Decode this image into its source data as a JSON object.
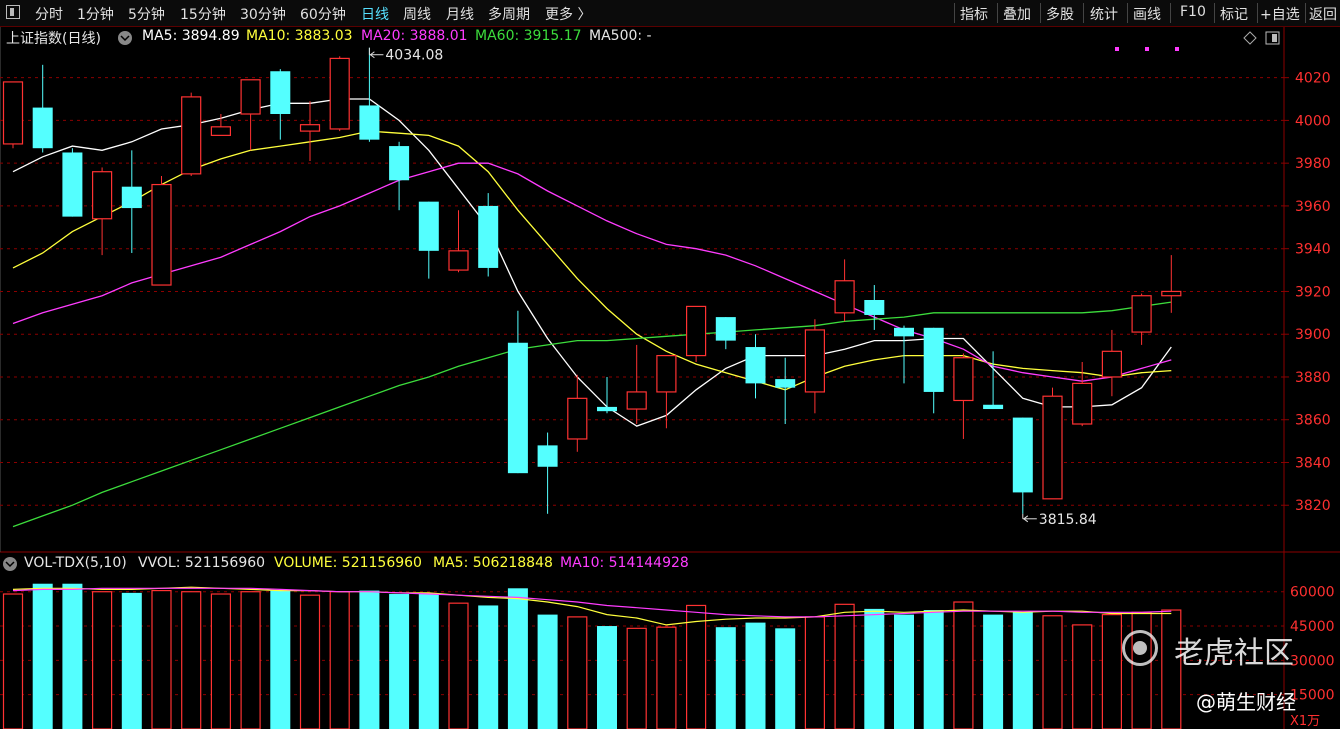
{
  "toolbar": {
    "left_items": [
      "分时",
      "1分钟",
      "5分钟",
      "15分钟",
      "30分钟",
      "60分钟",
      "日线",
      "周线",
      "月线",
      "多周期",
      "更多 〉"
    ],
    "active": "日线",
    "right_items": [
      "指标",
      "叠加",
      "多股",
      "统计",
      "画线",
      "F10",
      "标记",
      "+自选",
      "返回"
    ]
  },
  "header": {
    "symbol": "上证指数(日线)",
    "ma5": "MA5: 3894.89",
    "ma10": "MA10: 3883.03",
    "ma20": "MA20: 3888.01",
    "ma60": "MA60: 3915.17",
    "ma500": "MA500: -"
  },
  "colors": {
    "up": "#ff3232",
    "down": "#54ffff",
    "ma5": "#ffffff",
    "ma10": "#ffff3c",
    "ma20": "#ff3cff",
    "ma60": "#3cdc3c",
    "grid": "#8c0000",
    "volma5": "#ffff3c",
    "volma10": "#ff3cff"
  },
  "vol_header": {
    "name": "VOL-TDX(5,10)",
    "vvol": "VVOL: 521156960",
    "volume": "VOLUME: 521156960",
    "ma5": "MA5: 506218848",
    "ma10": "MA10: 514144928"
  },
  "watermark": {
    "name": "老虎社区",
    "author": "@萌生财经"
  },
  "scale_unit": "X1万",
  "chart_data": {
    "type": "candlestick",
    "price_axis": {
      "range": [
        3800,
        4032
      ],
      "ticks": [
        3820,
        3840,
        3860,
        3880,
        3900,
        3920,
        3940,
        3960,
        3980,
        4000,
        4020
      ]
    },
    "volume_axis": {
      "range": [
        0,
        66000
      ],
      "ticks": [
        45000,
        60000
      ],
      "extra_tick_labels": [
        "30000",
        "15000"
      ]
    },
    "annotations": [
      {
        "label": "4034.08",
        "index": 12,
        "kind": "high"
      },
      {
        "label": "3815.84",
        "index": 34,
        "kind": "low"
      }
    ],
    "candles": [
      {
        "o": 3989,
        "h": 4018,
        "l": 3987,
        "c": 4018
      },
      {
        "o": 4006,
        "h": 4026,
        "l": 3985,
        "c": 3987
      },
      {
        "o": 3985,
        "h": 3987,
        "l": 3955,
        "c": 3955
      },
      {
        "o": 3954,
        "h": 3978,
        "l": 3937,
        "c": 3976
      },
      {
        "o": 3969,
        "h": 3986,
        "l": 3938,
        "c": 3959
      },
      {
        "o": 3923,
        "h": 3974,
        "l": 3923,
        "c": 3970
      },
      {
        "o": 3975,
        "h": 4013,
        "l": 3974,
        "c": 4011
      },
      {
        "o": 3993,
        "h": 4003,
        "l": 3993,
        "c": 3997
      },
      {
        "o": 4003,
        "h": 4019,
        "l": 3986,
        "c": 4019
      },
      {
        "o": 4023,
        "h": 4024,
        "l": 3991,
        "c": 4003
      },
      {
        "o": 3995,
        "h": 4009,
        "l": 3981,
        "c": 3998
      },
      {
        "o": 3996,
        "h": 4030,
        "l": 3995,
        "c": 4029
      },
      {
        "o": 4007,
        "h": 4034,
        "l": 3990,
        "c": 3991
      },
      {
        "o": 3988,
        "h": 3990,
        "l": 3958,
        "c": 3972
      },
      {
        "o": 3962,
        "h": 3962,
        "l": 3926,
        "c": 3939
      },
      {
        "o": 3930,
        "h": 3958,
        "l": 3929,
        "c": 3939
      },
      {
        "o": 3960,
        "h": 3966,
        "l": 3927,
        "c": 3931
      },
      {
        "o": 3896,
        "h": 3911,
        "l": 3835,
        "c": 3835
      },
      {
        "o": 3848,
        "h": 3854,
        "l": 3816,
        "c": 3838
      },
      {
        "o": 3851,
        "h": 3881,
        "l": 3845,
        "c": 3870
      },
      {
        "o": 3866,
        "h": 3880,
        "l": 3863,
        "c": 3864
      },
      {
        "o": 3865,
        "h": 3895,
        "l": 3858,
        "c": 3873
      },
      {
        "o": 3873,
        "h": 3890,
        "l": 3856,
        "c": 3890
      },
      {
        "o": 3890,
        "h": 3913,
        "l": 3887,
        "c": 3913
      },
      {
        "o": 3908,
        "h": 3908,
        "l": 3893,
        "c": 3897
      },
      {
        "o": 3894,
        "h": 3900,
        "l": 3870,
        "c": 3877
      },
      {
        "o": 3879,
        "h": 3889,
        "l": 3858,
        "c": 3875
      },
      {
        "o": 3873,
        "h": 3907,
        "l": 3863,
        "c": 3902
      },
      {
        "o": 3910,
        "h": 3935,
        "l": 3906,
        "c": 3925
      },
      {
        "o": 3916,
        "h": 3923,
        "l": 3902,
        "c": 3909
      },
      {
        "o": 3903,
        "h": 3904,
        "l": 3877,
        "c": 3899
      },
      {
        "o": 3903,
        "h": 3903,
        "l": 3863,
        "c": 3873
      },
      {
        "o": 3869,
        "h": 3891,
        "l": 3851,
        "c": 3889
      },
      {
        "o": 3867,
        "h": 3892,
        "l": 3865,
        "c": 3865
      },
      {
        "o": 3861,
        "h": 3861,
        "l": 3816,
        "c": 3826
      },
      {
        "o": 3823,
        "h": 3875,
        "l": 3823,
        "c": 3871
      },
      {
        "o": 3858,
        "h": 3887,
        "l": 3857,
        "c": 3877
      },
      {
        "o": 3880,
        "h": 3902,
        "l": 3871,
        "c": 3892
      },
      {
        "o": 3901,
        "h": 3919,
        "l": 3895,
        "c": 3918
      },
      {
        "o": 3918,
        "h": 3937,
        "l": 3910,
        "c": 3920
      }
    ],
    "volume": [
      59000,
      63500,
      63500,
      60000,
      59500,
      60500,
      60000,
      59000,
      60000,
      60500,
      58500,
      60000,
      60500,
      59000,
      59000,
      55000,
      54000,
      61500,
      50000,
      49000,
      45000,
      44000,
      44500,
      54000,
      44500,
      46500,
      44000,
      49000,
      54500,
      52500,
      50000,
      52000,
      55500,
      50000,
      51000,
      49500,
      45500,
      50000,
      51000,
      52000
    ],
    "ma_price": {
      "ma5": [
        3976,
        3983,
        3988,
        3986,
        3990,
        3996,
        3998,
        4001,
        4005,
        4008,
        4008,
        4010,
        4010,
        4000,
        3986,
        3968,
        3950,
        3920,
        3898,
        3880,
        3866,
        3857,
        3862,
        3874,
        3884,
        3890,
        3890,
        3890,
        3893,
        3897,
        3897,
        3898,
        3898,
        3884,
        3870,
        3866,
        3866,
        3867,
        3875,
        3894
      ],
      "ma10": [
        3931,
        3938,
        3948,
        3955,
        3962,
        3970,
        3977,
        3982,
        3986,
        3988,
        3990,
        3992,
        3995,
        3994,
        3993,
        3988,
        3976,
        3958,
        3942,
        3926,
        3912,
        3900,
        3892,
        3886,
        3882,
        3878,
        3874,
        3880,
        3885,
        3888,
        3890,
        3890,
        3890,
        3886,
        3884,
        3883,
        3882,
        3880,
        3882,
        3883
      ],
      "ma20": [
        3905,
        3910,
        3914,
        3918,
        3924,
        3928,
        3932,
        3936,
        3942,
        3948,
        3955,
        3960,
        3966,
        3972,
        3976,
        3980,
        3980,
        3975,
        3967,
        3960,
        3953,
        3947,
        3942,
        3940,
        3937,
        3932,
        3926,
        3920,
        3914,
        3908,
        3902,
        3898,
        3893,
        3885,
        3882,
        3880,
        3878,
        3880,
        3884,
        3888
      ],
      "ma60": [
        3810,
        3815,
        3820,
        3826,
        3831,
        3836,
        3841,
        3846,
        3851,
        3856,
        3861,
        3866,
        3871,
        3876,
        3880,
        3885,
        3889,
        3893,
        3895,
        3897,
        3897,
        3898,
        3899,
        3900,
        3901,
        3902,
        3903,
        3904,
        3906,
        3907,
        3908,
        3910,
        3910,
        3910,
        3910,
        3910,
        3910,
        3911,
        3913,
        3915
      ]
    },
    "ma_volume": {
      "ma5": [
        61000,
        61500,
        61500,
        61000,
        61000,
        61500,
        62000,
        61500,
        61000,
        60500,
        60500,
        60000,
        60000,
        59500,
        59500,
        58500,
        57500,
        57000,
        55500,
        53500,
        50000,
        48500,
        45500,
        47000,
        48000,
        48500,
        48500,
        49000,
        51000,
        51500,
        51000,
        51500,
        52000,
        51500,
        51000,
        51500,
        51500,
        50500,
        50500,
        50500
      ],
      "ma10": [
        60500,
        61000,
        61000,
        61500,
        61500,
        61500,
        61500,
        61500,
        61500,
        61000,
        60500,
        60000,
        60000,
        59500,
        59000,
        58500,
        58000,
        57500,
        56500,
        55500,
        54000,
        53000,
        52000,
        51000,
        50000,
        49500,
        49000,
        49000,
        49500,
        50000,
        50500,
        51000,
        51500,
        51500,
        51500,
        51500,
        51000,
        51000,
        51000,
        51500
      ]
    }
  }
}
